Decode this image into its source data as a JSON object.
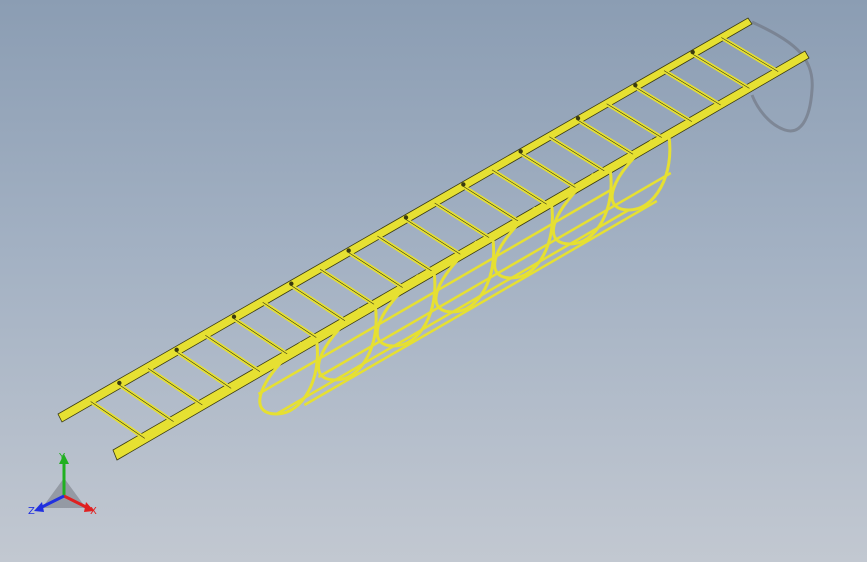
{
  "viewport": {
    "background_top": "#8b9db3",
    "background_bottom": "#c2c8d1",
    "model_color": "#e6e032",
    "model_edge_color": "#3a3a10",
    "shadow_color": "#6a6e78"
  },
  "triad": {
    "x_label": "X",
    "y_label": "Y",
    "z_label": "Z",
    "x_color": "#e02020",
    "y_color": "#20b020",
    "z_color": "#2030e0"
  }
}
